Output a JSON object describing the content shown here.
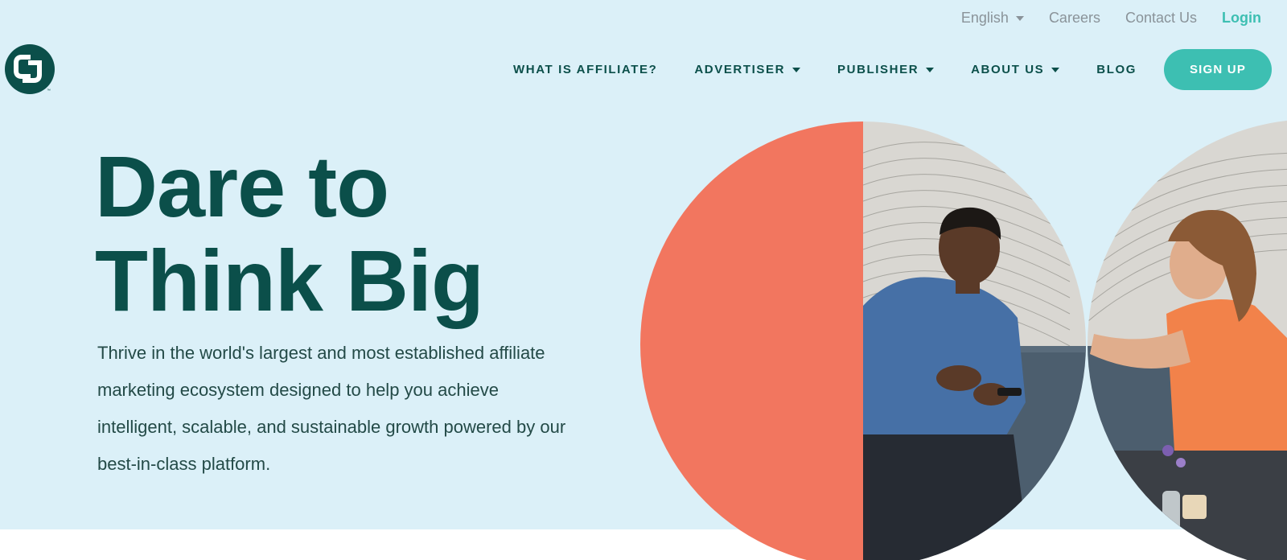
{
  "utility_nav": {
    "language": "English",
    "careers": "Careers",
    "contact": "Contact Us",
    "login": "Login"
  },
  "logo": {
    "icon": "cj-logo-icon",
    "trademark": "™"
  },
  "main_nav": {
    "items": [
      {
        "label": "WHAT IS AFFILIATE?",
        "dropdown": false
      },
      {
        "label": "ADVERTISER",
        "dropdown": true
      },
      {
        "label": "PUBLISHER",
        "dropdown": true
      },
      {
        "label": "ABOUT US",
        "dropdown": true
      },
      {
        "label": "BLOG",
        "dropdown": false
      }
    ],
    "signup": "SIGN UP"
  },
  "hero": {
    "headline_line1": "Dare to",
    "headline_line2": "Think Big",
    "description": "Thrive in the world's largest and most established affiliate marketing ecosystem designed to help you achieve intelligent, scalable, and sustainable growth powered by our best-in-class platform."
  },
  "colors": {
    "hero_bg": "#dbf0f8",
    "brand_dark": "#0b4f4a",
    "accent_teal": "#3dbfb2",
    "coral": "#f2765f"
  }
}
